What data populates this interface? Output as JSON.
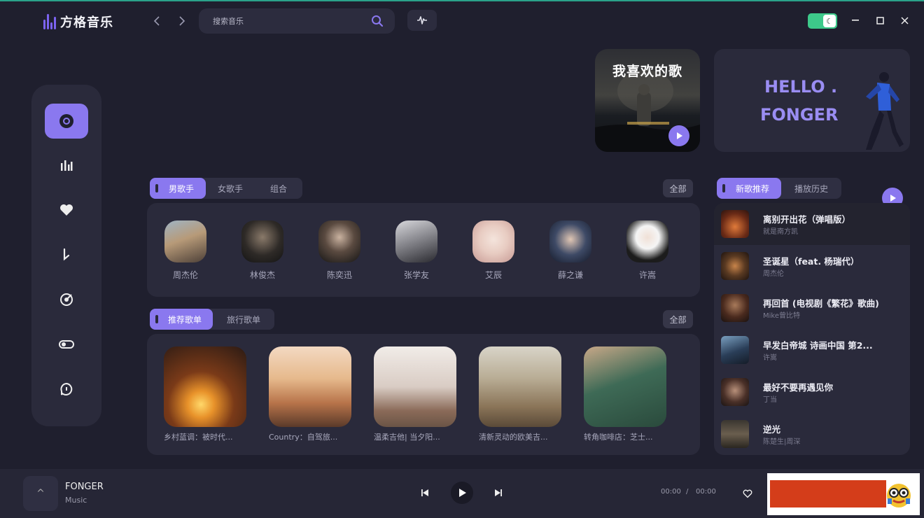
{
  "app": {
    "name": "方格音乐"
  },
  "header": {
    "back_icon": "chevron-left-icon",
    "forward_icon": "chevron-right-icon",
    "search_placeholder": "搜索音乐",
    "accent": "#8a78ef",
    "toggle_color": "#3dc98a"
  },
  "sidebar": {
    "items": [
      {
        "icon": "disc-icon",
        "active": true
      },
      {
        "icon": "chart-bars-icon"
      },
      {
        "icon": "heart-icon"
      },
      {
        "icon": "music-note-icon"
      },
      {
        "icon": "radio-target-icon"
      },
      {
        "icon": "toggle-icon"
      },
      {
        "icon": "chat-icon"
      }
    ]
  },
  "hero": {
    "favorite_title": "我喜欢的歌",
    "hello_line1": "HELLO .",
    "hello_line2": "FONGER"
  },
  "singers": {
    "tabs": [
      "男歌手",
      "女歌手",
      "组合"
    ],
    "all_label": "全部",
    "artists": [
      "周杰伦",
      "林俊杰",
      "陈奕迅",
      "张学友",
      "艾辰",
      "薛之谦",
      "许嵩"
    ]
  },
  "playlists": {
    "tabs": [
      "推荐歌单",
      "旅行歌单"
    ],
    "all_label": "全部",
    "items": [
      "乡村蓝调：被时代...",
      "Country：自驾旅...",
      "温柔吉他| 当夕阳...",
      "清新灵动的欧美吉...",
      "转角咖啡店：芝士..."
    ]
  },
  "new_songs": {
    "tabs": [
      "新歌推荐",
      "播放历史"
    ],
    "songs": [
      {
        "title": "离别开出花（弹唱版）",
        "artist": "就是南方凯"
      },
      {
        "title": "圣诞星（feat. 杨瑞代）",
        "artist": "周杰伦"
      },
      {
        "title": "再回首 (电视剧《繁花》歌曲)",
        "artist": "Mike曾比特"
      },
      {
        "title": "早发白帝城 诗画中国 第2...",
        "artist": "许嵩"
      },
      {
        "title": "最好不要再遇见你",
        "artist": "丁当"
      },
      {
        "title": "逆光",
        "artist": "陈楚生|周深"
      }
    ]
  },
  "player": {
    "expand_label": "^",
    "title": "FONGER",
    "subtitle": "Music",
    "current_time": "00:00",
    "separator": "/",
    "total_time": "00:00"
  }
}
